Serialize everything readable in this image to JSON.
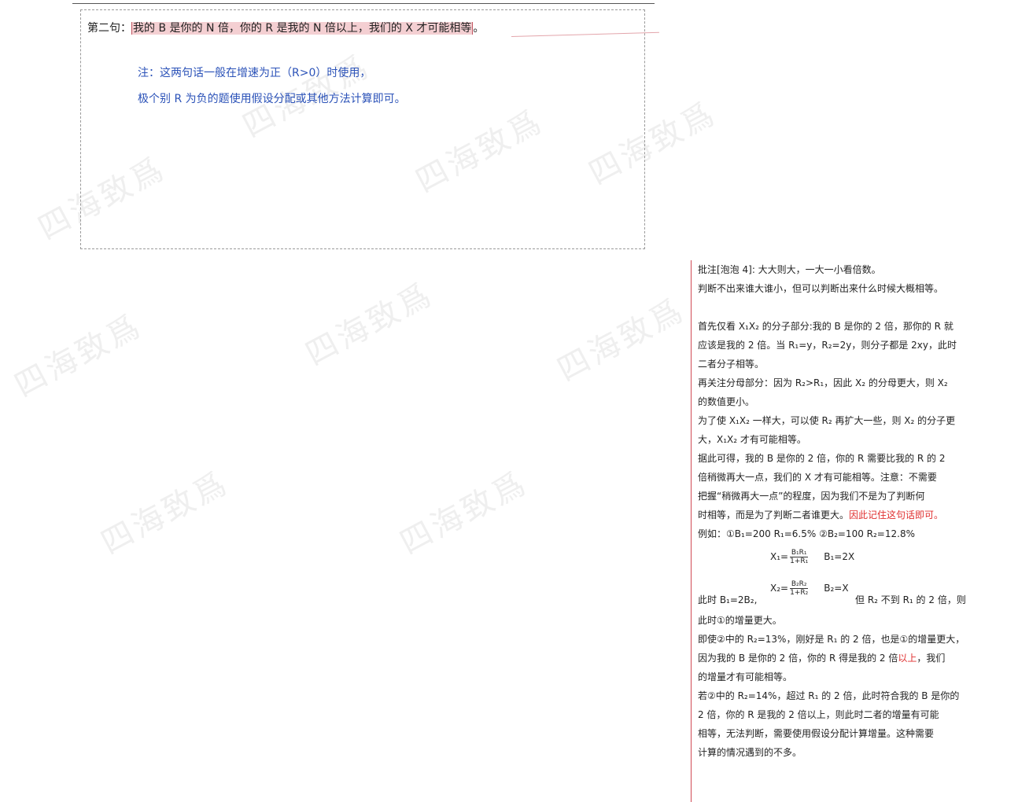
{
  "doc": {
    "sentence_prefix": "第二句：",
    "sentence_highlight": "我的 B 是你的 N 倍，你的 R 是我的 N 倍以上，我们的 X 才可能相等",
    "sentence_suffix": "。",
    "note_line1": "注：这两句话一般在增速为正（R>0）时使用，",
    "note_line2": "极个别 R 为负的题使用假设分配或其他方法计算即可。"
  },
  "comment": {
    "lines": [
      "批注[泡泡 4]: 大大则大，一大一小看倍数。",
      "判断不出来谁大谁小，但可以判断出来什么时候大概相等。",
      "",
      "首先仅看 X₁X₂ 的分子部分:我的 B 是你的 2 倍，那你的 R 就",
      "应该是我的 2 倍。当 R₁=y，R₂=2y，则分子都是 2xy，此时",
      "二者分子相等。",
      "再关注分母部分：因为 R₂>R₁，因此 X₂ 的分母更大，则 X₂",
      "的数值更小。",
      "为了使 X₁X₂ 一样大，可以使 R₂ 再扩大一些，则 X₂ 的分子更",
      "大，X₁X₂ 才有可能相等。",
      "据此可得，我的 B 是你的 2 倍，你的 R 需要比我的 R 的 2",
      "倍稍微再大一点，我们的 X 才有可能相等。注意：不需要",
      "把握“稍微再大一点”的程度，因为我们不是为了判断何"
    ],
    "line_timing": "时相等，而是为了判断二者谁更大。",
    "line_timing_red": "因此记住这句话即可。",
    "example_line": "例如：①B₁=200 R₁=6.5%  ②B₂=100 R₂=12.8%",
    "formula1_lhs": "X₁=",
    "formula1_num": "B₁R₁",
    "formula1_den": "1+R₁",
    "formula1_rhs": "B₁=2X",
    "formula2_lhs": "X₂=",
    "formula2_num": "B₂R₂",
    "formula2_den": "1+R₂",
    "formula2_rhs": "B₂=X",
    "form_left": "此时 B₁=2B₂,",
    "form_right": "但 R₂ 不到 R₁ 的 2 倍，则",
    "lines_after": [
      "此时①的增量更大。",
      "即使②中的 R₂=13%，刚好是 R₁ 的 2 倍，也是①的增量更大，"
    ],
    "line_because_a": "因为我的 B 是你的 2 倍，你的 R 得是我的 2 倍",
    "line_because_red": "以上",
    "line_because_b": "，我们",
    "lines_end": [
      "的增量才有可能相等。",
      "若②中的 R₂=14%，超过 R₁ 的 2 倍，此时符合我的 B 是你的",
      "2 倍，你的 R 是我的 2 倍以上，则此时二者的增量有可能",
      "相等，无法判断，需要使用假设分配计算增量。这种需要",
      "计算的情况遇到的不多。"
    ]
  },
  "colors": {
    "highlight": "#f4cfd2",
    "note_blue": "#2b52b8",
    "comment_red": "#e03030",
    "comment_border": "#d04a55"
  }
}
